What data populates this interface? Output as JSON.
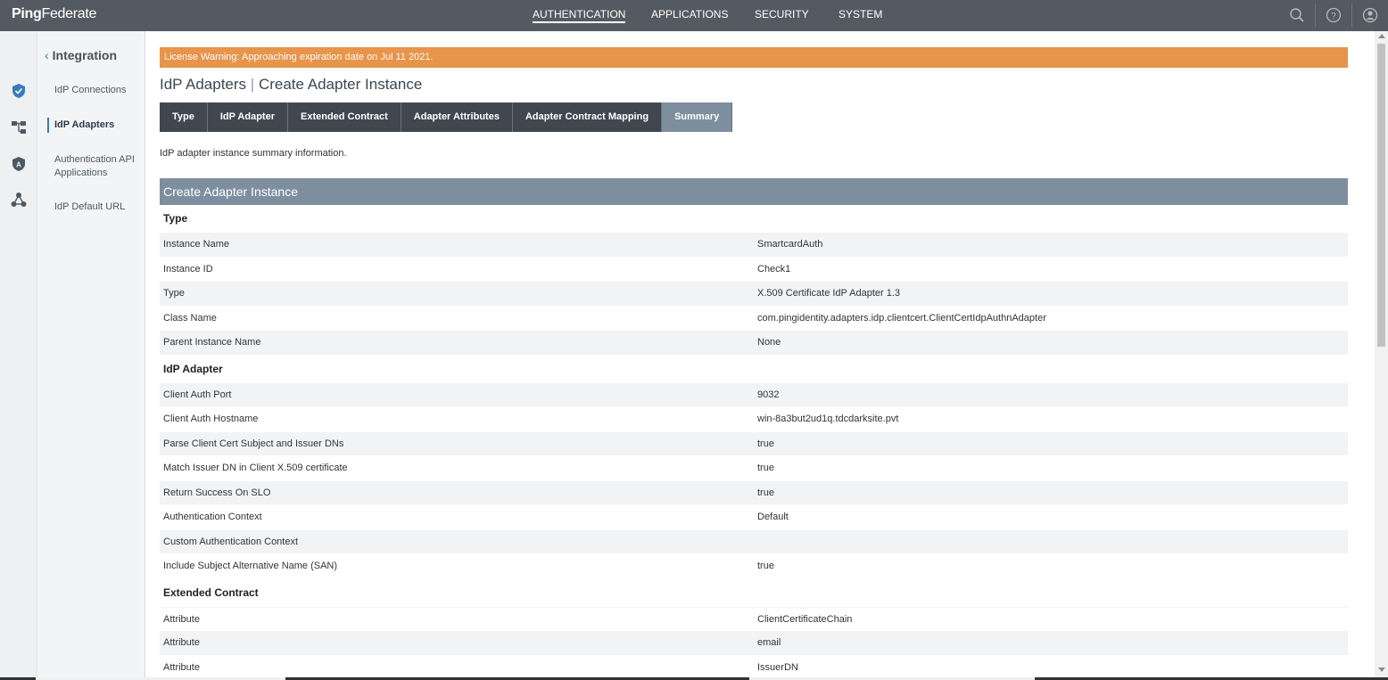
{
  "app": {
    "logo_bold": "Ping",
    "logo_regular": "Federate"
  },
  "topnav": {
    "authentication": "AUTHENTICATION",
    "applications": "APPLICATIONS",
    "security": "SECURITY",
    "system": "SYSTEM"
  },
  "icons": {
    "search": "search-icon",
    "help": "help-icon",
    "user": "user-icon",
    "rail": [
      "shield-check-icon",
      "hierarchy-icon",
      "lock-shield-icon",
      "network-icon"
    ]
  },
  "sidebar": {
    "back_label": "Integration",
    "items": [
      {
        "label": "IdP Connections"
      },
      {
        "label": "IdP Adapters"
      },
      {
        "label": "Authentication API Applications"
      },
      {
        "label": "IdP Default URL"
      }
    ]
  },
  "license_warning": "License Warning: Approaching expiration date on Jul 11 2021.",
  "page": {
    "breadcrumb_parent": "IdP Adapters",
    "breadcrumb_sep": "|",
    "breadcrumb_current": "Create Adapter Instance",
    "description": "IdP adapter instance summary information."
  },
  "tabs": [
    {
      "label": "Type"
    },
    {
      "label": "IdP Adapter"
    },
    {
      "label": "Extended Contract"
    },
    {
      "label": "Adapter Attributes"
    },
    {
      "label": "Adapter Contract Mapping"
    },
    {
      "label": "Summary"
    }
  ],
  "summary": {
    "header": "Create Adapter Instance",
    "sections": [
      {
        "title": "Type",
        "rows": [
          {
            "key": "Instance Name",
            "value": "SmartcardAuth"
          },
          {
            "key": "Instance ID",
            "value": "Check1"
          },
          {
            "key": "Type",
            "value": "X.509 Certificate IdP Adapter 1.3"
          },
          {
            "key": "Class Name",
            "value": "com.pingidentity.adapters.idp.clientcert.ClientCertIdpAuthnAdapter"
          },
          {
            "key": "Parent Instance Name",
            "value": "None"
          }
        ]
      },
      {
        "title": "IdP Adapter",
        "rows": [
          {
            "key": "Client Auth Port",
            "value": "9032"
          },
          {
            "key": "Client Auth Hostname",
            "value": "win-8a3but2ud1q.tdcdarksite.pvt"
          },
          {
            "key": "Parse Client Cert Subject and Issuer DNs",
            "value": "true"
          },
          {
            "key": "Match Issuer DN in Client X.509 certificate",
            "value": "true"
          },
          {
            "key": "Return Success On SLO",
            "value": "true"
          },
          {
            "key": "Authentication Context",
            "value": "Default"
          },
          {
            "key": "Custom Authentication Context",
            "value": ""
          },
          {
            "key": "Include Subject Alternative Name (SAN)",
            "value": "true"
          }
        ]
      },
      {
        "title": "Extended Contract",
        "rows": [
          {
            "key": "Attribute",
            "value": "ClientCertificateChain"
          },
          {
            "key": "Attribute",
            "value": "email"
          },
          {
            "key": "Attribute",
            "value": "IssuerDN"
          }
        ]
      }
    ]
  },
  "colors": {
    "topbar": "#545a62",
    "license": "#e8944a",
    "tab": "#40474f",
    "tab_active": "#7d8e9f",
    "accent": "#3a7bbf"
  }
}
